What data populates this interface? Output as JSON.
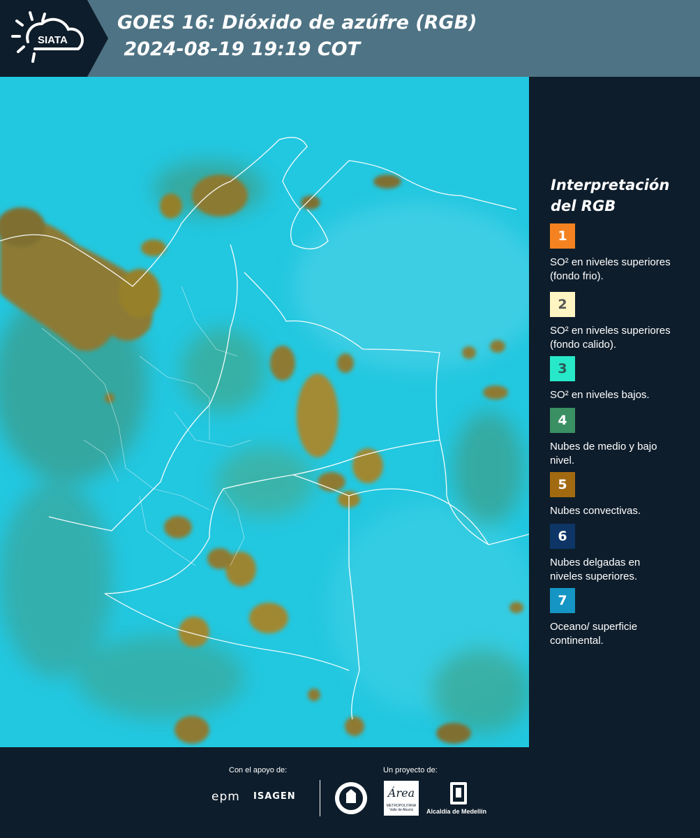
{
  "header": {
    "logo_text": "SIATA",
    "title_line1": "GOES 16: Dióxido de azúfre (RGB)",
    "title_line2": " 2024-08-19 19:19 COT"
  },
  "map": {
    "description_layer": "satellite-rgb-so2",
    "colors": {
      "ocean_land": "#22c7e0",
      "convective": "#8b6d1e",
      "mid_low": "#3c9a7a",
      "borders": "#ffffff"
    }
  },
  "legend": {
    "title_line1": "Interpretación",
    "title_line2": "del RGB",
    "items": [
      {
        "number": "1",
        "color": "#f58220",
        "text_color": "#ffffff",
        "text": "SO² en niveles superiores (fondo frio)."
      },
      {
        "number": "2",
        "color": "#fff5c2",
        "text_color": "#555555",
        "text": "SO² en niveles superiores (fondo calido)."
      },
      {
        "number": "3",
        "color": "#27e8c8",
        "text_color": "#2a5a55",
        "text": "SO² en niveles bajos."
      },
      {
        "number": "4",
        "color": "#3a8f63",
        "text_color": "#ffffff",
        "text": "Nubes de medio y bajo nivel."
      },
      {
        "number": "5",
        "color": "#a26a10",
        "text_color": "#ffffff",
        "text": "Nubes convectivas."
      },
      {
        "number": "6",
        "color": "#0d3566",
        "text_color": "#ffffff",
        "text": "Nubes delgadas en niveles superiores."
      },
      {
        "number": "7",
        "color": "#1595c3",
        "text_color": "#ffffff",
        "text": "Oceano/ superficie continental."
      }
    ]
  },
  "footer": {
    "support_label": "Con el apoyo de:",
    "project_label": "Un proyecto de:",
    "epm_text": "epm",
    "isagen_text": "ISAGEN",
    "area_text": "Área",
    "area_sub": "METROPOLITANA",
    "area_sub2": "Valle de Aburrá",
    "alcaldia_text": "Alcaldía de Medellín"
  }
}
